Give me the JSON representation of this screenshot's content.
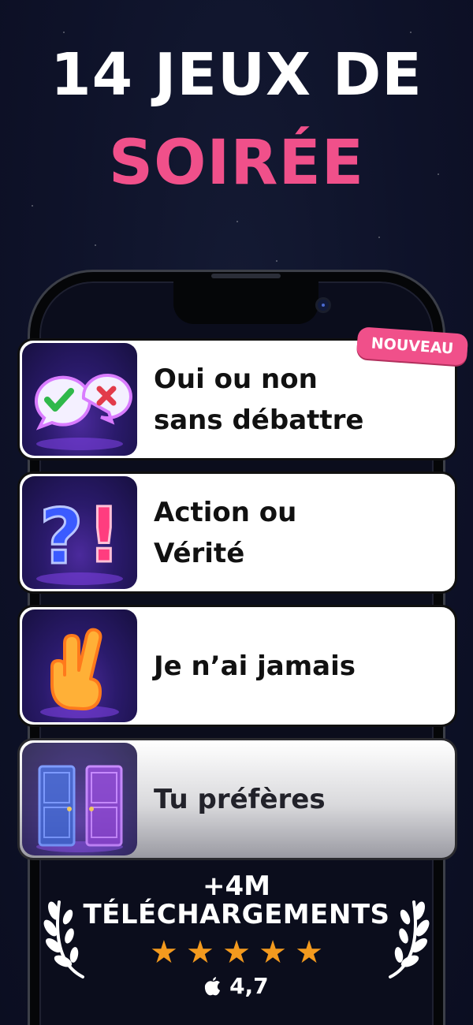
{
  "headline": {
    "line1": "14 JEUX DE",
    "line2": "SOIRÉE"
  },
  "badge": "NOUVEAU",
  "games": [
    {
      "title_line1": "Oui ou non",
      "title_line2": "sans débattre",
      "icon": "yes-no-bubbles-icon"
    },
    {
      "title_line1": "Action ou",
      "title_line2": "Vérité",
      "icon": "question-exclamation-icon"
    },
    {
      "title_line1": "Je n’ai jamais",
      "title_line2": "",
      "icon": "crossed-fingers-icon"
    },
    {
      "title_line1": "Tu préfères",
      "title_line2": "",
      "icon": "doors-icon"
    }
  ],
  "stats": {
    "downloads": "+4M",
    "downloads_label": "TÉLÉCHARGEMENTS",
    "stars": 5,
    "rating": "4,7"
  },
  "colors": {
    "accent": "#f0508a",
    "star": "#f39a1e",
    "background": "#0e1229"
  }
}
